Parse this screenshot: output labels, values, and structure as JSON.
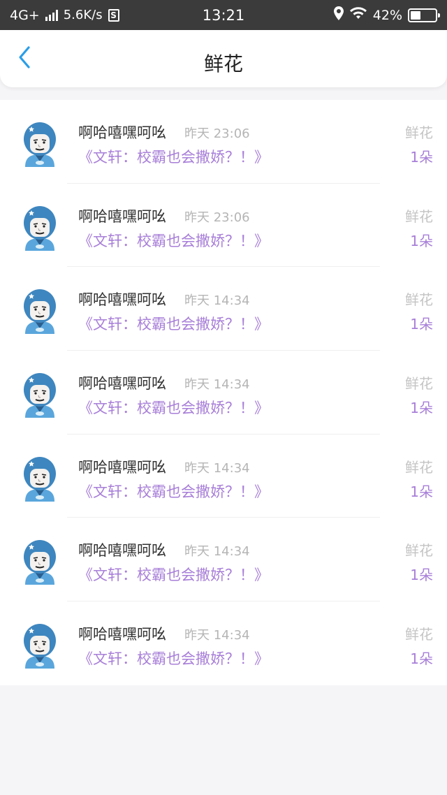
{
  "status_bar": {
    "network": "4G+",
    "speed": "5.6K/s",
    "sim_icon_label": "S",
    "time": "13:21",
    "battery": "42%",
    "battery_level": 0.42
  },
  "header": {
    "title": "鲜花",
    "back_icon": "chevron-left-icon",
    "accent": "#2a9ee8"
  },
  "colors": {
    "purple": "#a87fd8",
    "muted": "#b5b5b5"
  },
  "items": [
    {
      "user": "啊哈嘻嘿呵吆",
      "time": "昨天 23:06",
      "book": "《文轩：校霸也会撒娇？！》",
      "gift": "鲜花",
      "count": "1朵"
    },
    {
      "user": "啊哈嘻嘿呵吆",
      "time": "昨天 23:06",
      "book": "《文轩：校霸也会撒娇？！》",
      "gift": "鲜花",
      "count": "1朵"
    },
    {
      "user": "啊哈嘻嘿呵吆",
      "time": "昨天 14:34",
      "book": "《文轩：校霸也会撒娇？！》",
      "gift": "鲜花",
      "count": "1朵"
    },
    {
      "user": "啊哈嘻嘿呵吆",
      "time": "昨天 14:34",
      "book": "《文轩：校霸也会撒娇？！》",
      "gift": "鲜花",
      "count": "1朵"
    },
    {
      "user": "啊哈嘻嘿呵吆",
      "time": "昨天 14:34",
      "book": "《文轩：校霸也会撒娇？！》",
      "gift": "鲜花",
      "count": "1朵"
    },
    {
      "user": "啊哈嘻嘿呵吆",
      "time": "昨天 14:34",
      "book": "《文轩：校霸也会撒娇？！》",
      "gift": "鲜花",
      "count": "1朵"
    },
    {
      "user": "啊哈嘻嘿呵吆",
      "time": "昨天 14:34",
      "book": "《文轩：校霸也会撒娇？！》",
      "gift": "鲜花",
      "count": "1朵"
    }
  ]
}
